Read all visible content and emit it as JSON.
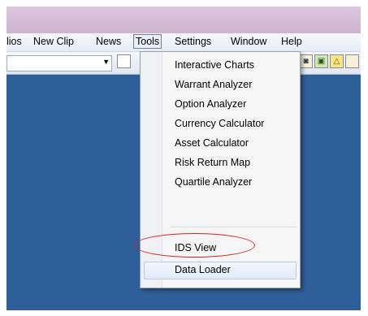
{
  "menubar": {
    "items": [
      "lios",
      "New Clip",
      "News",
      "Tools",
      "Settings",
      "Window",
      "Help"
    ],
    "active": "Tools"
  },
  "toolbar": {
    "dropdown_arrow": "▼"
  },
  "tools_menu": {
    "items": [
      "Interactive Charts",
      "Warrant Analyzer",
      "Option Analyzer",
      "Currency Calculator",
      "Asset Calculator",
      "Risk Return Map",
      "Quartile Analyzer",
      "IDS View",
      "Data Loader"
    ],
    "highlighted": "Data Loader",
    "circled": "IDS View"
  },
  "colors": {
    "workspace": "#2f5f98",
    "annotation": "#d5252a"
  }
}
